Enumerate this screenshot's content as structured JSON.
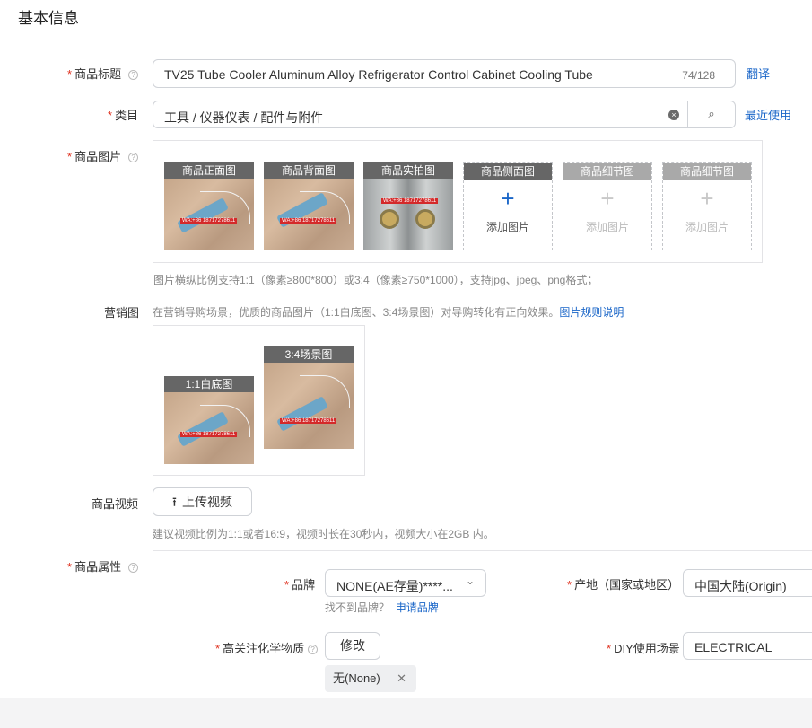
{
  "section": {
    "title": "基本信息"
  },
  "title_field": {
    "label": "商品标题",
    "value": "TV25  Tube Cooler Aluminum Alloy Refrigerator Control Cabinet Cooling Tube",
    "counter": "74/128",
    "translate_link": "翻译"
  },
  "category_field": {
    "label": "类目",
    "value": "工具 / 仪器仪表 / 配件与附件",
    "recent_link": "最近使用"
  },
  "images_field": {
    "label": "商品图片",
    "slots": [
      {
        "caption": "商品正面图"
      },
      {
        "caption": "商品背面图"
      },
      {
        "caption": "商品实拍图"
      },
      {
        "caption": "商品侧面图",
        "add_text": "添加图片"
      },
      {
        "caption": "商品细节图",
        "add_text": "添加图片"
      },
      {
        "caption": "商品细节图",
        "add_text": "添加图片"
      }
    ],
    "hint": "图片横纵比例支持1:1（像素≥800*800）或3:4（像素≥750*1000），支持jpg、jpeg、png格式；",
    "photo_text": "WA:+86 18717278611"
  },
  "marketing_field": {
    "label": "营销图",
    "hint": "在营销导购场景，优质的商品图片（1:1白底图、3:4场景图）对导购转化有正向效果。",
    "rules_link": "图片规则说明",
    "slots": [
      {
        "caption": "1:1白底图"
      },
      {
        "caption": "3:4场景图"
      }
    ]
  },
  "video_field": {
    "label": "商品视频",
    "upload_button": "上传视频",
    "hint": "建议视频比例为1:1或者16:9，视频时长在30秒内，视频大小在2GB 内。"
  },
  "attributes_field": {
    "label": "商品属性",
    "brand": {
      "label": "品牌",
      "value": "NONE(AE存量)****...",
      "not_found": "找不到品牌？",
      "apply_link": "申请品牌"
    },
    "origin": {
      "label": "产地（国家或地区）",
      "value": "中国大陆(Origin)"
    },
    "chemical": {
      "label": "高关注化学物质",
      "edit_button": "修改",
      "tag": "无(None)"
    },
    "diy_scene": {
      "label": "DIY使用场景",
      "value": "ELECTRICAL"
    }
  },
  "icons": {
    "help": "?",
    "search": "⌕",
    "clear": "×",
    "chevron": "⌄",
    "upload": "⭱",
    "plus": "+",
    "remove": "✕"
  },
  "colors": {
    "link": "#1a66c8",
    "required": "#e0301e",
    "caption_bg": "#666666"
  }
}
